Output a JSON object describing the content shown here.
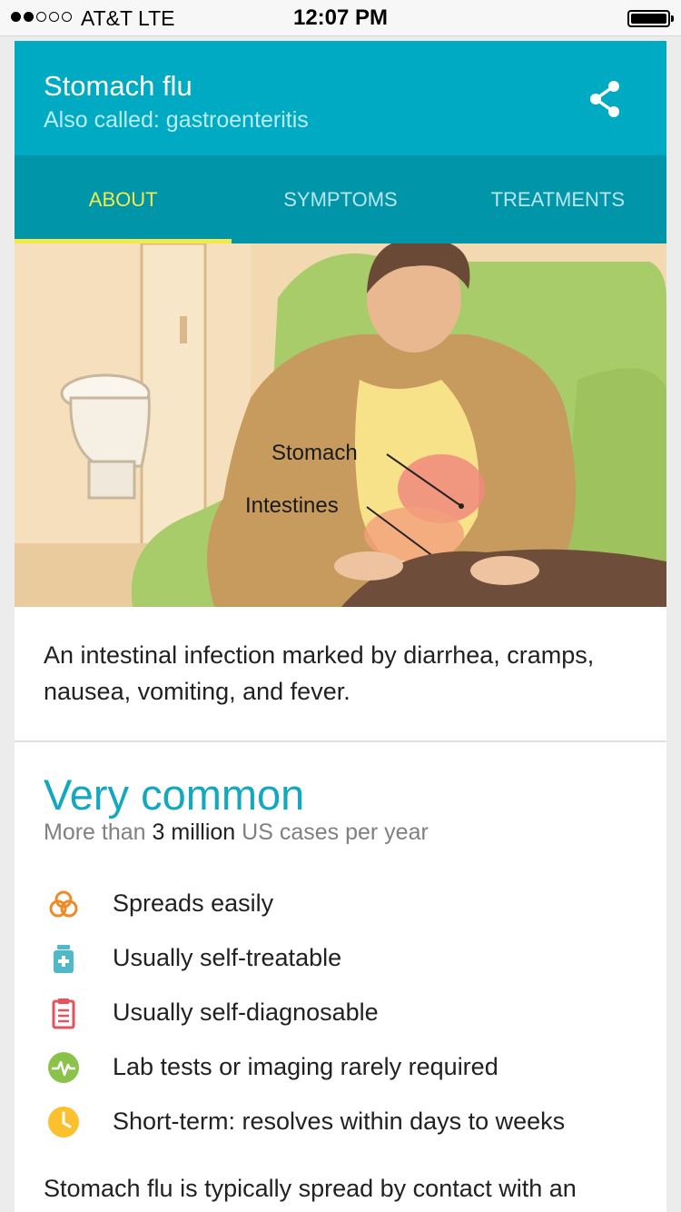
{
  "status_bar": {
    "carrier": "AT&T   LTE",
    "time": "12:07 PM"
  },
  "header": {
    "title": "Stomach flu",
    "subtitle": "Also called: gastroenteritis",
    "share_icon": "share-icon"
  },
  "tabs": [
    {
      "label": "ABOUT",
      "active": true
    },
    {
      "label": "SYMPTOMS",
      "active": false
    },
    {
      "label": "TREATMENTS",
      "active": false
    }
  ],
  "illustration": {
    "labels": [
      "Stomach",
      "Intestines"
    ]
  },
  "description": "An intestinal infection marked by diarrhea, cramps, nausea, vomiting, and fever.",
  "prevalence": {
    "heading": "Very common",
    "prefix": "More than ",
    "count": "3 million",
    "suffix": " US cases per year"
  },
  "facts": [
    {
      "icon": "contagious-icon",
      "text": "Spreads easily",
      "color": "#f08a24"
    },
    {
      "icon": "medicine-bottle-icon",
      "text": "Usually self-treatable",
      "color": "#4fb8c9"
    },
    {
      "icon": "clipboard-icon",
      "text": "Usually self-diagnosable",
      "color": "#e8505b"
    },
    {
      "icon": "pulse-icon",
      "text": "Lab tests or imaging rarely required",
      "color": "#8bc34a"
    },
    {
      "icon": "clock-icon",
      "text": "Short-term: resolves within days to weeks",
      "color": "#fbc02d"
    }
  ],
  "more_text": "Stomach flu is typically spread by contact with an",
  "colors": {
    "header": "#00aac3",
    "tabs": "#0095a8",
    "active_tab": "#f5e94a",
    "accent": "#14a8c0"
  }
}
